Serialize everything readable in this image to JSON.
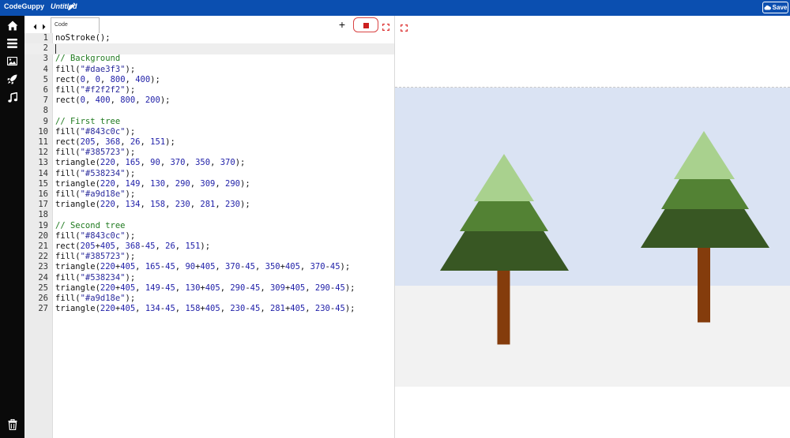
{
  "app": {
    "brand": "CodeGuppy",
    "filename": "Untitled",
    "save_label": "Save"
  },
  "sidebar": {
    "items": [
      {
        "icon": "home-icon"
      },
      {
        "icon": "menu-icon"
      },
      {
        "icon": "image-icon"
      },
      {
        "icon": "rocket-icon"
      },
      {
        "icon": "music-icon"
      },
      {
        "icon": "trash-icon"
      }
    ]
  },
  "editor": {
    "tab_label": "Code",
    "plus_label": "+",
    "lines": [
      "noStroke();",
      "",
      "// Background",
      "fill(\"#dae3f3\");",
      "rect(0, 0, 800, 400);",
      "fill(\"#f2f2f2\");",
      "rect(0, 400, 800, 200);",
      "",
      "// First tree",
      "fill(\"#843c0c\");",
      "rect(205, 368, 26, 151);",
      "fill(\"#385723\");",
      "triangle(220, 165, 90, 370, 350, 370);",
      "fill(\"#538234\");",
      "triangle(220, 149, 130, 290, 309, 290);",
      "fill(\"#a9d18e\");",
      "triangle(220, 134, 158, 230, 281, 230);",
      "",
      "// Second tree",
      "fill(\"#843c0c\");",
      "rect(205+405, 368-45, 26, 151);",
      "fill(\"#385723\");",
      "triangle(220+405, 165-45, 90+405, 370-45, 350+405, 370-45);",
      "fill(\"#538234\");",
      "triangle(220+405, 149-45, 130+405, 290-45, 309+405, 290-45);",
      "fill(\"#a9d18e\");",
      "triangle(220+405, 134-45, 158+405, 230-45, 281+405, 230-45);"
    ]
  },
  "colors": {
    "topbar": "#0b4fb0",
    "sky": "#dae3f3",
    "ground": "#f2f2f2",
    "trunk": "#843c0c",
    "dark_green": "#385723",
    "mid_green": "#538234",
    "light_green": "#a9d18e"
  }
}
